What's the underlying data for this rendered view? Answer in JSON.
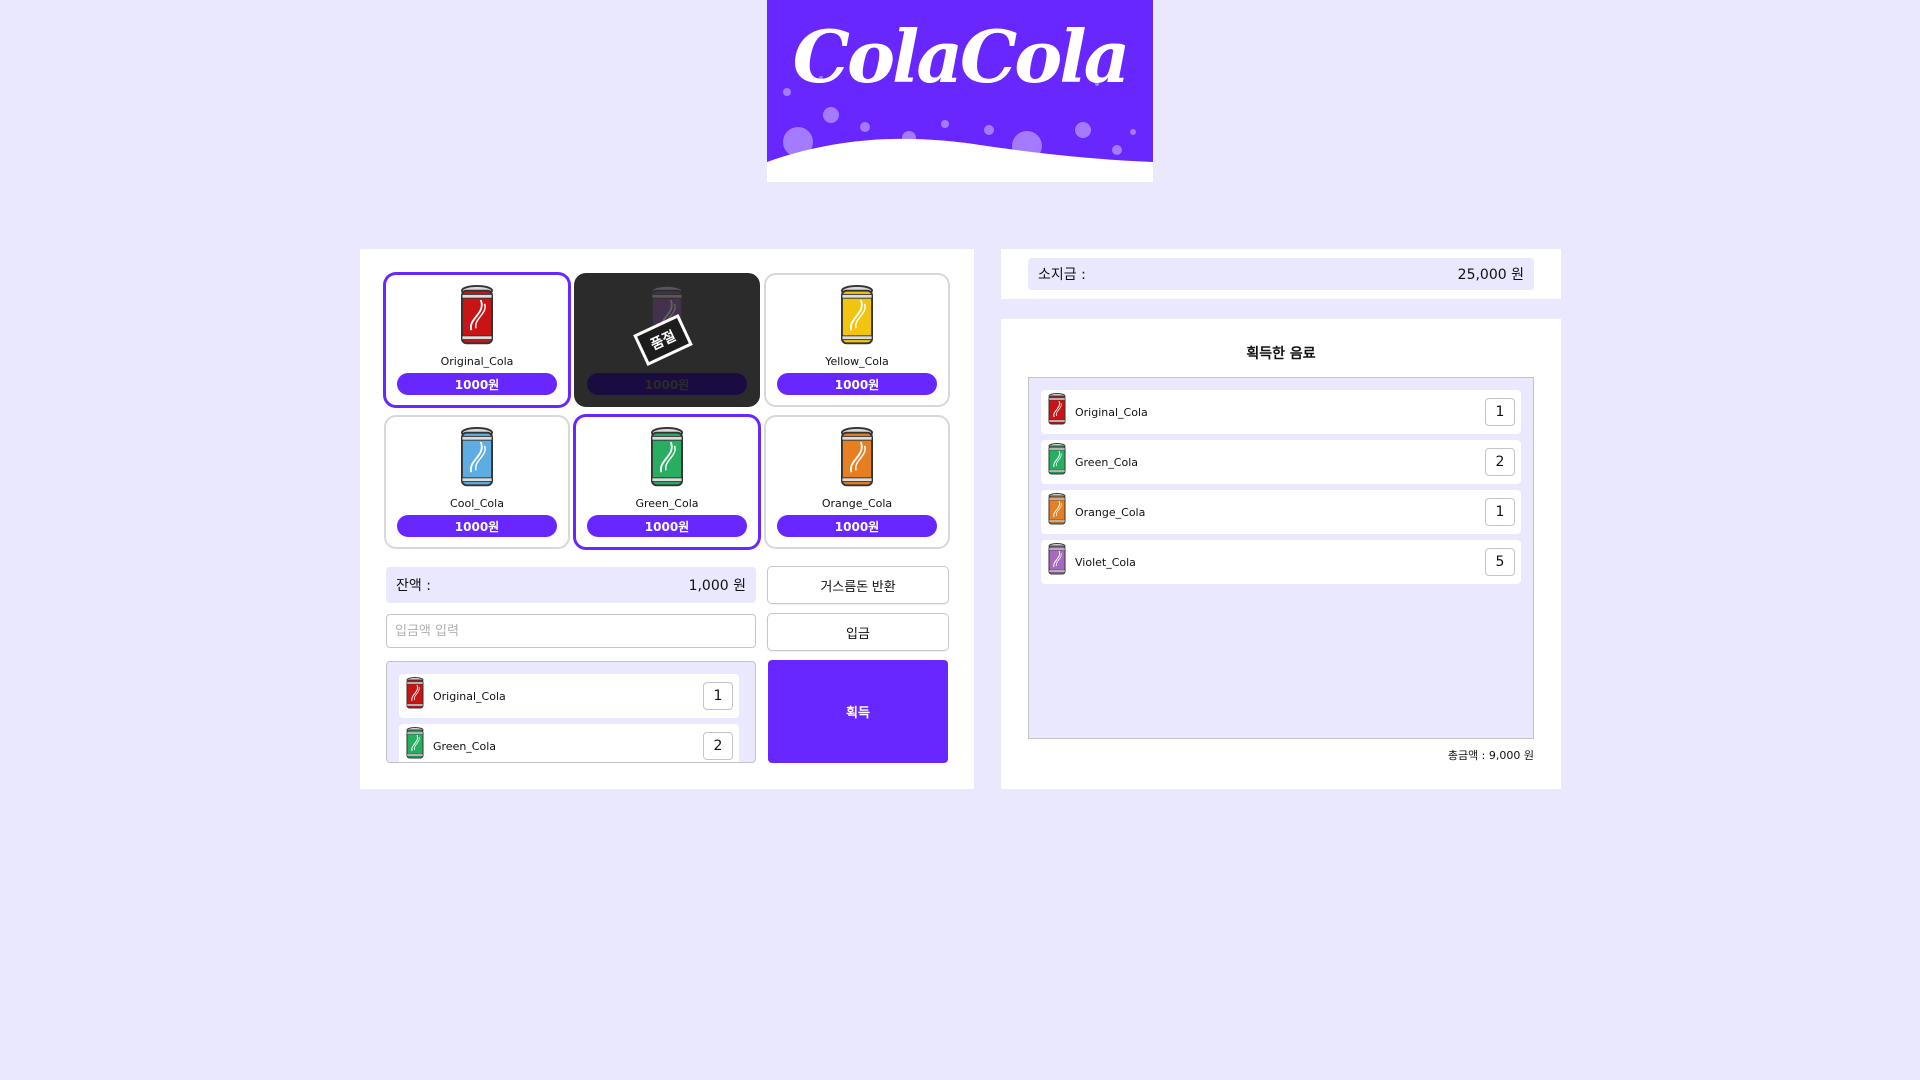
{
  "logo": {
    "text": "ColaCola",
    "bg_color": "#6927ff"
  },
  "colors": {
    "accent": "#6927ff",
    "background": "#eae8fe",
    "soldout": "#2b2b2b"
  },
  "vending": {
    "items": [
      {
        "name": "Original_Cola",
        "price": "1000원",
        "can_color": "#c81414",
        "selected": true,
        "soldout": false
      },
      {
        "name": "Violet_Cola",
        "price": "1000원",
        "can_color": "#8e44ad",
        "selected": false,
        "soldout": true,
        "soldout_label": "품절"
      },
      {
        "name": "Yellow_Cola",
        "price": "1000원",
        "can_color": "#f1c40f",
        "selected": false,
        "soldout": false
      },
      {
        "name": "Cool_Cola",
        "price": "1000원",
        "can_color": "#5dade2",
        "selected": false,
        "soldout": false
      },
      {
        "name": "Green_Cola",
        "price": "1000원",
        "can_color": "#27ae60",
        "selected": true,
        "soldout": false
      },
      {
        "name": "Orange_Cola",
        "price": "1000원",
        "can_color": "#e67e22",
        "selected": false,
        "soldout": false
      }
    ],
    "balance_label": "잔액 :",
    "balance_value": "1,000 원",
    "return_button": "거스름돈 반환",
    "deposit_placeholder": "입금액 입력",
    "deposit_button": "입금",
    "get_button": "획득",
    "staged": [
      {
        "name": "Original_Cola",
        "qty": "1",
        "can_color": "#c81414"
      },
      {
        "name": "Green_Cola",
        "qty": "2",
        "can_color": "#27ae60"
      }
    ]
  },
  "wallet": {
    "label": "소지금 :",
    "value": "25,000 원"
  },
  "acquired": {
    "title": "획득한 음료",
    "items": [
      {
        "name": "Original_Cola",
        "qty": "1",
        "can_color": "#c81414"
      },
      {
        "name": "Green_Cola",
        "qty": "2",
        "can_color": "#27ae60"
      },
      {
        "name": "Orange_Cola",
        "qty": "1",
        "can_color": "#e67e22"
      },
      {
        "name": "Violet_Cola",
        "qty": "5",
        "can_color": "#a569bd"
      }
    ],
    "total": "총금액 : 9,000 원"
  }
}
